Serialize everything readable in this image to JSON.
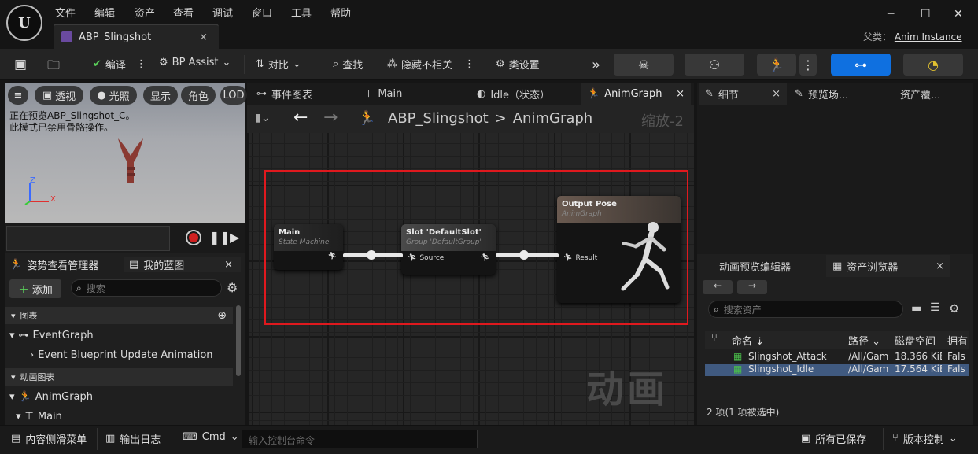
{
  "menu": [
    "文件",
    "编辑",
    "资产",
    "查看",
    "调试",
    "窗口",
    "工具",
    "帮助"
  ],
  "doc_tab": {
    "label": "ABP_Slingshot",
    "close": "×"
  },
  "window_controls": {
    "minimize": "─",
    "maximize": "☐",
    "close": "✕"
  },
  "parent": {
    "label": "父类：",
    "value": "Anim Instance"
  },
  "toolbar": {
    "compile": "编译",
    "bp_assist": "BP Assist",
    "diff": "对比",
    "find": "查找",
    "hide_unrelated": "隐藏不相关",
    "class_settings": "类设置"
  },
  "viewport": {
    "buttons": [
      "透视",
      "光照",
      "显示",
      "角色",
      "LOD"
    ],
    "overlay_line1": "正在预览ABP_Slingshot_C。",
    "overlay_line2": "此模式已禁用骨骼操作。",
    "axis_z": "Z",
    "axis_x": "X"
  },
  "left_tabs": {
    "pose_watch": "姿势查看管理器",
    "my_blueprint": "我的蓝图",
    "close": "×"
  },
  "my_blueprint": {
    "add_label": "添加",
    "search_placeholder": "搜索",
    "section_graphs": "图表",
    "event_graph": "EventGraph",
    "event_update": "Event Blueprint Update Animation",
    "section_anim_graphs": "动画图表",
    "anim_graph": "AnimGraph",
    "main": "Main"
  },
  "graph_tabs": [
    {
      "label": "事件图表"
    },
    {
      "label": "Main"
    },
    {
      "label": "Idle（状态）"
    },
    {
      "label": "AnimGraph",
      "close": "×"
    }
  ],
  "breadcrumb": {
    "root": "ABP_Slingshot",
    "sep": ">",
    "current": "AnimGraph",
    "zoom": "缩放-2"
  },
  "nodes": {
    "main": {
      "title": "Main",
      "subtitle": "State Machine"
    },
    "slot": {
      "title": "Slot 'DefaultSlot'",
      "subtitle": "Group 'DefaultGroup'",
      "pin": "Source"
    },
    "output": {
      "title": "Output Pose",
      "subtitle": "AnimGraph",
      "pin": "Result"
    }
  },
  "graph_watermark": "动画",
  "right_tabs": {
    "details": "细节",
    "preview_scene": "预览场...",
    "asset_override": "资产覆...",
    "close": "×"
  },
  "bottom_right_tabs": {
    "anim_preview_editor": "动画预览编辑器",
    "asset_browser": "资产浏览器",
    "close": "×"
  },
  "asset_browser": {
    "search_placeholder": "搜索资产",
    "columns": [
      "命名",
      "路径",
      "磁盘空间",
      "拥有"
    ],
    "rows": [
      {
        "name": "Slingshot_Attack",
        "path": "/All/Gam",
        "size": "18.366 KiB",
        "owned": "Fals"
      },
      {
        "name": "Slingshot_Idle",
        "path": "/All/Gam",
        "size": "17.564 KiB",
        "owned": "Fals"
      }
    ],
    "count": "2 项(1 项被选中)"
  },
  "statusbar": {
    "content_drawer": "内容侧滑菜单",
    "output_log": "输出日志",
    "cmd": "Cmd",
    "cmd_placeholder": "输入控制台命令",
    "all_saved": "所有已保存",
    "source_control": "版本控制"
  },
  "colors": {
    "accent_blue": "#0f70e0",
    "selection": "#e0191e",
    "state_machine_header": "#2d2d2d",
    "slot_header": "#4a4a4a",
    "output_header": "#6a5a50"
  }
}
